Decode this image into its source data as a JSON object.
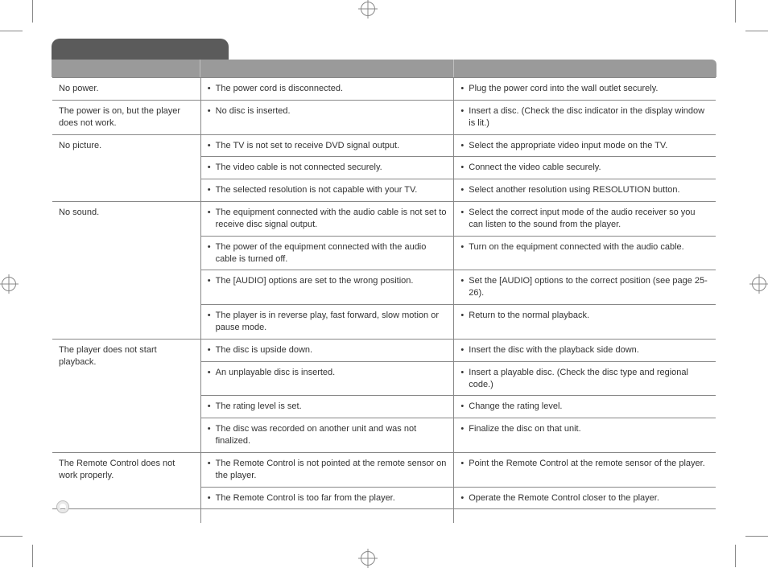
{
  "title_block": "",
  "headers": {
    "symptom": "",
    "cause": "",
    "correction": ""
  },
  "groups": [
    {
      "symptom": "No power.",
      "rows": [
        {
          "cause": "The power cord is disconnected.",
          "fix": "Plug the power cord into the wall outlet securely."
        }
      ]
    },
    {
      "symptom": "The power is on, but the player does not work.",
      "rows": [
        {
          "cause": "No disc is inserted.",
          "fix": "Insert a disc. (Check the disc indicator in the display window is lit.)"
        }
      ]
    },
    {
      "symptom": "No picture.",
      "rows": [
        {
          "cause": "The TV is not set to receive DVD signal output.",
          "fix": "Select the appropriate video input mode on the TV."
        },
        {
          "cause": "The video cable is not connected securely.",
          "fix": "Connect the video cable securely."
        },
        {
          "cause": "The selected resolution is not capable with your TV.",
          "fix": "Select another resolution using RESOLUTION button."
        }
      ]
    },
    {
      "symptom": "No sound.",
      "rows": [
        {
          "cause": "The equipment connected with the audio cable is not set to receive disc signal output.",
          "fix": "Select the correct input mode of the audio receiver so you can listen to the sound from the player."
        },
        {
          "cause": "The power of the equipment connected with the audio cable is turned off.",
          "fix": "Turn on the equipment connected with the audio cable."
        },
        {
          "cause": "The [AUDIO] options are set to the wrong position.",
          "fix": "Set the [AUDIO] options to the correct position (see page 25-26)."
        },
        {
          "cause": "The player is in reverse play, fast forward, slow motion or pause mode.",
          "fix": "Return to the normal playback."
        }
      ]
    },
    {
      "symptom": "The player does not start playback.",
      "rows": [
        {
          "cause": "The disc is upside down.",
          "fix": "Insert the disc with the playback side down."
        },
        {
          "cause": "An unplayable disc is inserted.",
          "fix": "Insert a playable disc. (Check the disc type and regional code.)"
        },
        {
          "cause": "The rating level is set.",
          "fix": "Change the rating level."
        },
        {
          "cause": "The disc was recorded on another unit and was not finalized.",
          "fix": "Finalize the disc on that unit."
        }
      ]
    },
    {
      "symptom": "The Remote Control does not work properly.",
      "rows": [
        {
          "cause": "The Remote Control is not pointed at the remote sensor on the player.",
          "fix": "Point the Remote Control at the remote sensor of the player."
        },
        {
          "cause": "The Remote Control is too far from the player.",
          "fix": "Operate the Remote Control closer to the player."
        }
      ]
    }
  ]
}
